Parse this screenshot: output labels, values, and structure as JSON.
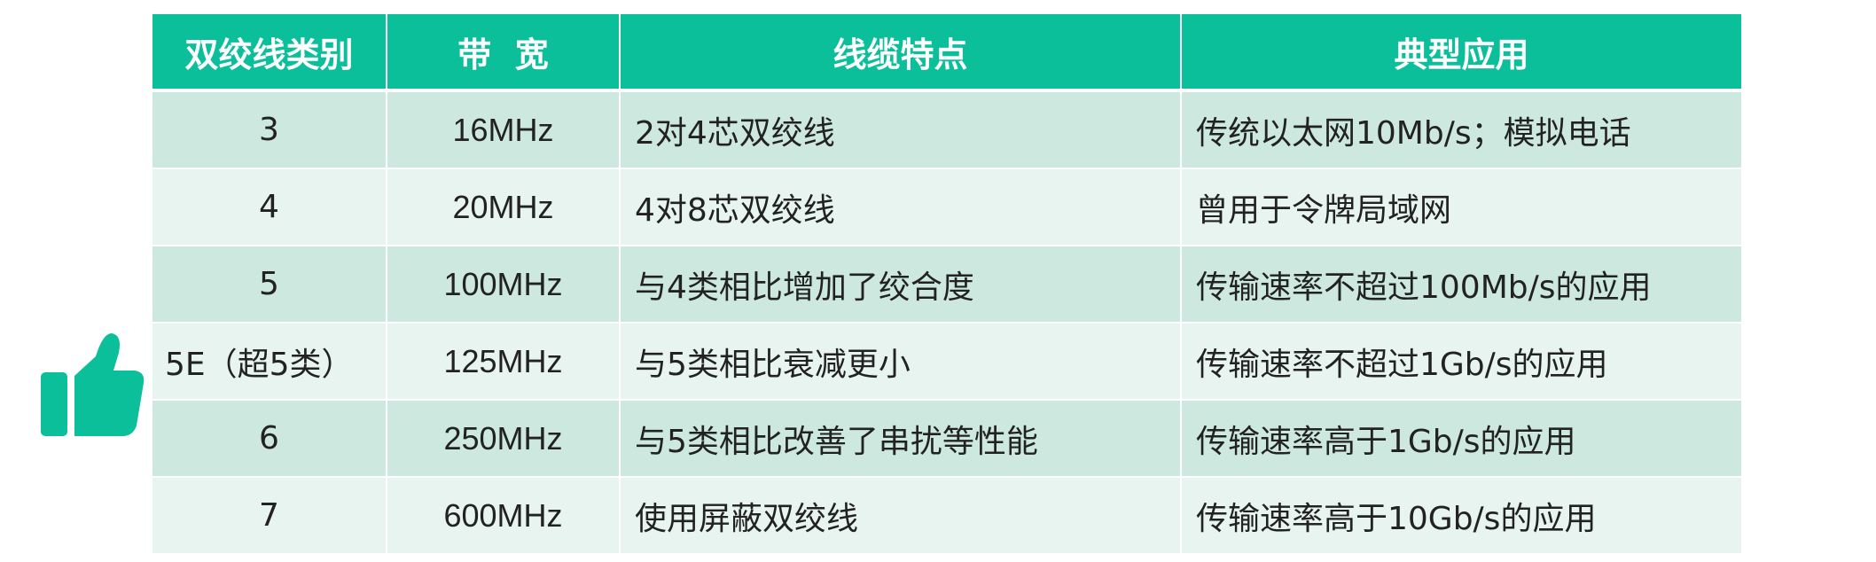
{
  "icon": "thumbs-up-icon",
  "colors": {
    "accent": "#0bbf9a",
    "row_odd": "#cde9df",
    "row_even": "#e7f4ef"
  },
  "table": {
    "headers": [
      "双绞线类别",
      "带  宽",
      "线缆特点",
      "典型应用"
    ],
    "rows": [
      {
        "category": "3",
        "bandwidth": "16MHz",
        "feature": "2对4芯双绞线",
        "application": "传统以太网10Mb/s；模拟电话"
      },
      {
        "category": "4",
        "bandwidth": "20MHz",
        "feature": "4对8芯双绞线",
        "application": "曾用于令牌局域网"
      },
      {
        "category": "5",
        "bandwidth": "100MHz",
        "feature": "与4类相比增加了绞合度",
        "application": "传输速率不超过100Mb/s的应用"
      },
      {
        "category": "5E（超5类）",
        "bandwidth": "125MHz",
        "feature": "与5类相比衰减更小",
        "application": "传输速率不超过1Gb/s的应用"
      },
      {
        "category": "6",
        "bandwidth": "250MHz",
        "feature": "与5类相比改善了串扰等性能",
        "application": "传输速率高于1Gb/s的应用"
      },
      {
        "category": "7",
        "bandwidth": "600MHz",
        "feature": "使用屏蔽双绞线",
        "application": "传输速率高于10Gb/s的应用"
      }
    ]
  }
}
